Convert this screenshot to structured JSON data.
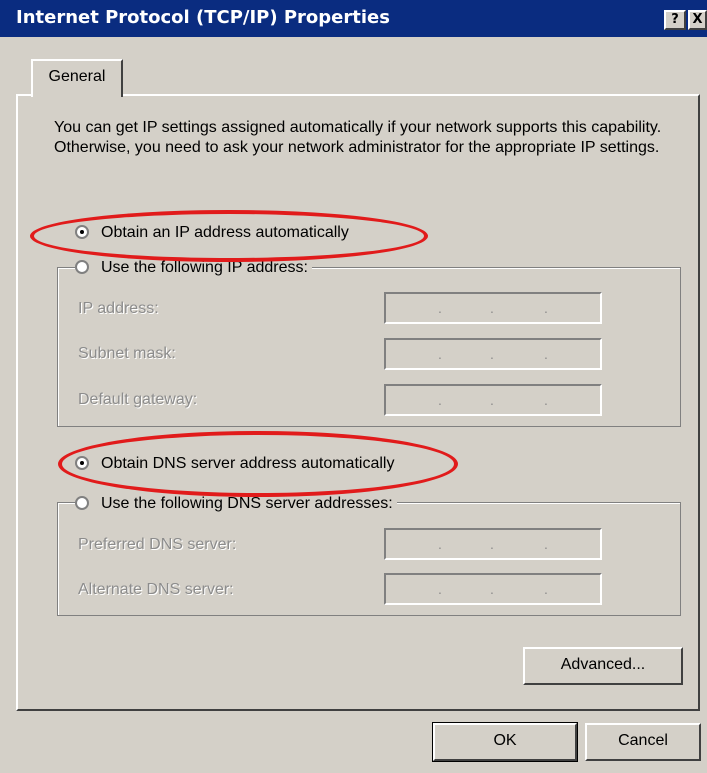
{
  "window": {
    "title": "Internet Protocol (TCP/IP) Properties",
    "help_button": "?",
    "close_button": "X"
  },
  "tabs": [
    {
      "label": "General",
      "active": true
    }
  ],
  "intro_text": "You can get IP settings assigned automatically if your network supports this capability. Otherwise, you need to ask your network administrator for the appropriate IP settings.",
  "ip_section": {
    "auto_option": {
      "label": "Obtain an IP address automatically",
      "checked": true
    },
    "manual_option": {
      "label": "Use the following IP address:",
      "checked": false
    },
    "fields": [
      {
        "label": "IP address:",
        "value": " .  .  . "
      },
      {
        "label": "Subnet mask:",
        "value": " .  .  . "
      },
      {
        "label": "Default gateway:",
        "value": " .  .  . "
      }
    ]
  },
  "dns_section": {
    "auto_option": {
      "label": "Obtain DNS server address automatically",
      "checked": true
    },
    "manual_option": {
      "label": "Use the following DNS server addresses:",
      "checked": false
    },
    "fields": [
      {
        "label": "Preferred DNS server:",
        "value": " .  .  . "
      },
      {
        "label": "Alternate DNS server:",
        "value": " .  .  . "
      }
    ]
  },
  "buttons": {
    "advanced": "Advanced...",
    "ok": "OK",
    "cancel": "Cancel"
  },
  "colors": {
    "titlebar": "#0a2c80",
    "dialog_face": "#d4d0c8",
    "highlight_annotation": "#e11b1b",
    "disabled_text": "#8c8c8c"
  }
}
